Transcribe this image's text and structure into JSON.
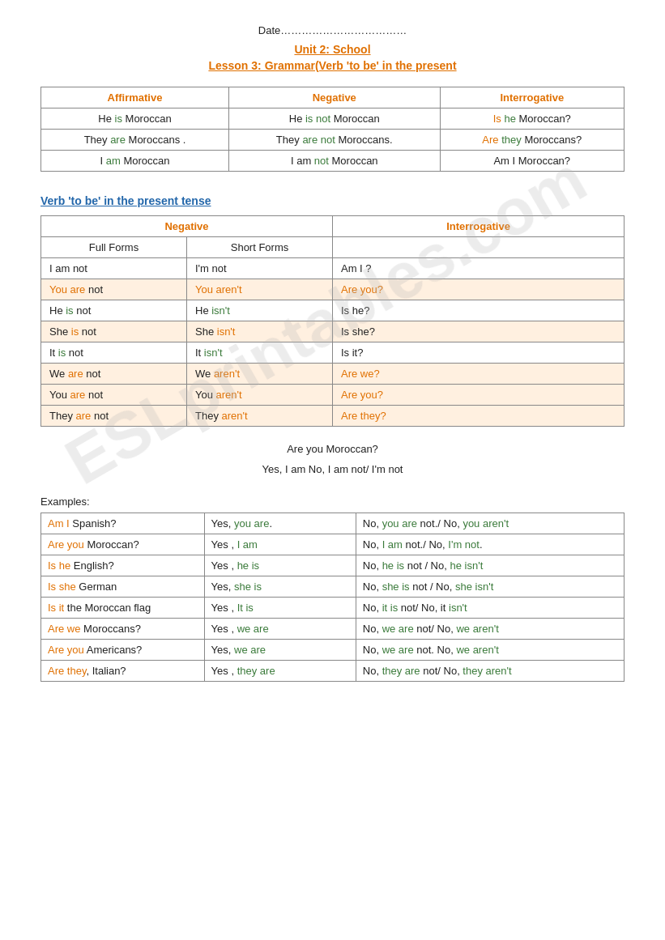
{
  "header": {
    "date_label": "Date………………………………",
    "unit_title": "Unit 2:  School",
    "lesson_title": "Lesson 3: Grammar(Verb 'to be' in the present"
  },
  "table1": {
    "headers": [
      "Affirmative",
      "Negative",
      "Interrogative"
    ],
    "rows": [
      {
        "affirmative": [
          "He ",
          "is",
          " Moroccan"
        ],
        "negative": [
          "He ",
          "is not",
          " Moroccan"
        ],
        "interrogative": [
          "Is ",
          "he",
          " Moroccan?"
        ]
      },
      {
        "affirmative": [
          "They ",
          "are",
          " Moroccans ."
        ],
        "negative": [
          "They ",
          "are not",
          " Moroccans."
        ],
        "interrogative": [
          "Are ",
          "they",
          " Moroccans?"
        ]
      },
      {
        "affirmative": [
          "I ",
          "am",
          " Moroccan"
        ],
        "negative": [
          "I am ",
          "not",
          " Moroccan"
        ],
        "interrogative": [
          "Am I Moroccan?"
        ]
      }
    ]
  },
  "section2_title": "Verb 'to be' in the present tense",
  "table2": {
    "neg_header": "Negative",
    "int_header": "Interrogative",
    "full_forms_header": "Full Forms",
    "short_forms_header": "Short Forms",
    "rows": [
      {
        "full": [
          "I am not"
        ],
        "short": [
          "I'm not"
        ],
        "int": [
          "Am I ?"
        ],
        "highlight": false
      },
      {
        "full": [
          "You are not"
        ],
        "short": [
          "You aren't"
        ],
        "int": [
          "Are you?"
        ],
        "highlight": true
      },
      {
        "full": [
          "He is not"
        ],
        "short": [
          "He isn't"
        ],
        "int": [
          "Is he?"
        ],
        "highlight": false
      },
      {
        "full": [
          "She is not"
        ],
        "short": [
          "She isn't"
        ],
        "int": [
          "Is she?"
        ],
        "highlight": true
      },
      {
        "full": [
          "It is not"
        ],
        "short": [
          "It isn't"
        ],
        "int": [
          "Is it?"
        ],
        "highlight": false
      },
      {
        "full": [
          "We are not"
        ],
        "short": [
          "We aren't"
        ],
        "int": [
          "Are we?"
        ],
        "highlight": true
      },
      {
        "full": [
          "You are not"
        ],
        "short": [
          "You aren't"
        ],
        "int": [
          "Are you?"
        ],
        "highlight": true
      },
      {
        "full": [
          "They are not"
        ],
        "short": [
          "They aren't"
        ],
        "int": [
          "Are they?"
        ],
        "highlight": true
      }
    ]
  },
  "example_question": "Are you Moroccan?",
  "example_answers": "Yes, I am        No, I am not/ I'm not",
  "examples_label": "Examples:",
  "table3": {
    "rows": [
      {
        "q": [
          {
            "t": "Am I",
            "c": "orange"
          },
          {
            "t": " Spanish?",
            "c": ""
          }
        ],
        "yes": [
          {
            "t": "Yes, ",
            "c": ""
          },
          {
            "t": "you are",
            "c": "green"
          },
          {
            "t": ".",
            "c": ""
          }
        ],
        "no": [
          {
            "t": "No, ",
            "c": ""
          },
          {
            "t": "you are",
            "c": "green"
          },
          {
            "t": " not./ No, ",
            "c": ""
          },
          {
            "t": "you aren't",
            "c": "green"
          }
        ]
      },
      {
        "q": [
          {
            "t": "Are you",
            "c": "orange"
          },
          {
            "t": " Moroccan?",
            "c": ""
          }
        ],
        "yes": [
          {
            "t": "Yes , ",
            "c": ""
          },
          {
            "t": "I am",
            "c": "green"
          }
        ],
        "no": [
          {
            "t": "No, ",
            "c": ""
          },
          {
            "t": "I am",
            "c": "green"
          },
          {
            "t": " not./ No, ",
            "c": ""
          },
          {
            "t": "I'm not",
            "c": "green"
          },
          {
            "t": ".",
            "c": ""
          }
        ]
      },
      {
        "q": [
          {
            "t": "Is he",
            "c": "orange"
          },
          {
            "t": " English?",
            "c": ""
          }
        ],
        "yes": [
          {
            "t": "Yes , ",
            "c": ""
          },
          {
            "t": "he is",
            "c": "green"
          }
        ],
        "no": [
          {
            "t": "No, ",
            "c": ""
          },
          {
            "t": "he is",
            "c": "green"
          },
          {
            "t": " not / No, ",
            "c": ""
          },
          {
            "t": "he isn't",
            "c": "green"
          }
        ]
      },
      {
        "q": [
          {
            "t": "Is she",
            "c": "orange"
          },
          {
            "t": " German",
            "c": ""
          }
        ],
        "yes": [
          {
            "t": "Yes, ",
            "c": ""
          },
          {
            "t": "she is",
            "c": "green"
          }
        ],
        "no": [
          {
            "t": "No, ",
            "c": ""
          },
          {
            "t": "she is",
            "c": "green"
          },
          {
            "t": " not / No, ",
            "c": ""
          },
          {
            "t": "she isn't",
            "c": "green"
          }
        ]
      },
      {
        "q": [
          {
            "t": "Is it",
            "c": "orange"
          },
          {
            "t": " the Moroccan flag",
            "c": ""
          }
        ],
        "yes": [
          {
            "t": "Yes , ",
            "c": ""
          },
          {
            "t": "It is",
            "c": "green"
          }
        ],
        "no": [
          {
            "t": "No, ",
            "c": ""
          },
          {
            "t": "it is",
            "c": "green"
          },
          {
            "t": " not/ No, it ",
            "c": ""
          },
          {
            "t": "isn't",
            "c": "green"
          }
        ]
      },
      {
        "q": [
          {
            "t": "Are we",
            "c": "orange"
          },
          {
            "t": " Moroccans?",
            "c": ""
          }
        ],
        "yes": [
          {
            "t": "Yes , ",
            "c": ""
          },
          {
            "t": "we are",
            "c": "green"
          }
        ],
        "no": [
          {
            "t": " No, ",
            "c": ""
          },
          {
            "t": "we are",
            "c": "green"
          },
          {
            "t": " not/ No, ",
            "c": ""
          },
          {
            "t": "we aren't",
            "c": "green"
          }
        ]
      },
      {
        "q": [
          {
            "t": "Are you",
            "c": "orange"
          },
          {
            "t": " Americans?",
            "c": ""
          }
        ],
        "yes": [
          {
            "t": "Yes, ",
            "c": ""
          },
          {
            "t": "we are",
            "c": "green"
          }
        ],
        "no": [
          {
            "t": " No, ",
            "c": ""
          },
          {
            "t": "we are",
            "c": "green"
          },
          {
            "t": " not. No, ",
            "c": ""
          },
          {
            "t": "we aren't",
            "c": "green"
          }
        ]
      },
      {
        "q": [
          {
            "t": "Are they",
            "c": "orange"
          },
          {
            "t": ", Italian?",
            "c": ""
          }
        ],
        "yes": [
          {
            "t": "Yes , ",
            "c": ""
          },
          {
            "t": "they are",
            "c": "green"
          }
        ],
        "no": [
          {
            "t": "No, ",
            "c": ""
          },
          {
            "t": "they are",
            "c": "green"
          },
          {
            "t": " not/ No, ",
            "c": ""
          },
          {
            "t": "they aren't",
            "c": "green"
          }
        ]
      }
    ]
  }
}
